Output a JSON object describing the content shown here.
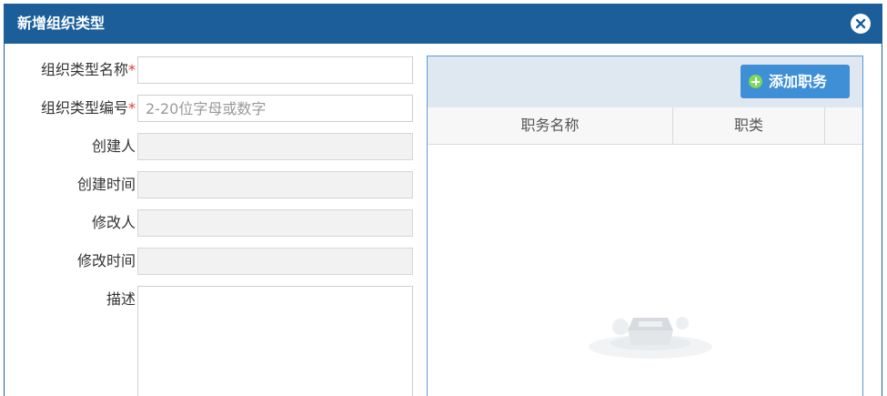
{
  "dialog": {
    "title": "新增组织类型",
    "close_icon": "close-circle-icon"
  },
  "form": {
    "fields": [
      {
        "label": "组织类型名称",
        "required": true,
        "value": "",
        "placeholder": ""
      },
      {
        "label": "组织类型编号",
        "required": true,
        "value": "",
        "placeholder": "2-20位字母或数字"
      },
      {
        "label": "创建人",
        "required": false,
        "value": "",
        "placeholder": "",
        "disabled": true
      },
      {
        "label": "创建时间",
        "required": false,
        "value": "",
        "placeholder": "",
        "disabled": true
      },
      {
        "label": "修改人",
        "required": false,
        "value": "",
        "placeholder": "",
        "disabled": true
      },
      {
        "label": "修改时间",
        "required": false,
        "value": "",
        "placeholder": "",
        "disabled": true
      }
    ],
    "description": {
      "label": "描述",
      "value": ""
    },
    "required_mark": "*"
  },
  "positions_grid": {
    "add_button": {
      "label": "添加职务",
      "icon": "plus-circle-icon"
    },
    "columns": [
      "职务名称",
      "职类"
    ],
    "rows": [],
    "empty_icon": "empty-data-illustration-icon"
  },
  "colors": {
    "title_bar": "#1b5e9a",
    "add_button": "#3f8fd6",
    "required": "#e53935",
    "grid_border": "#5b9bd5"
  }
}
